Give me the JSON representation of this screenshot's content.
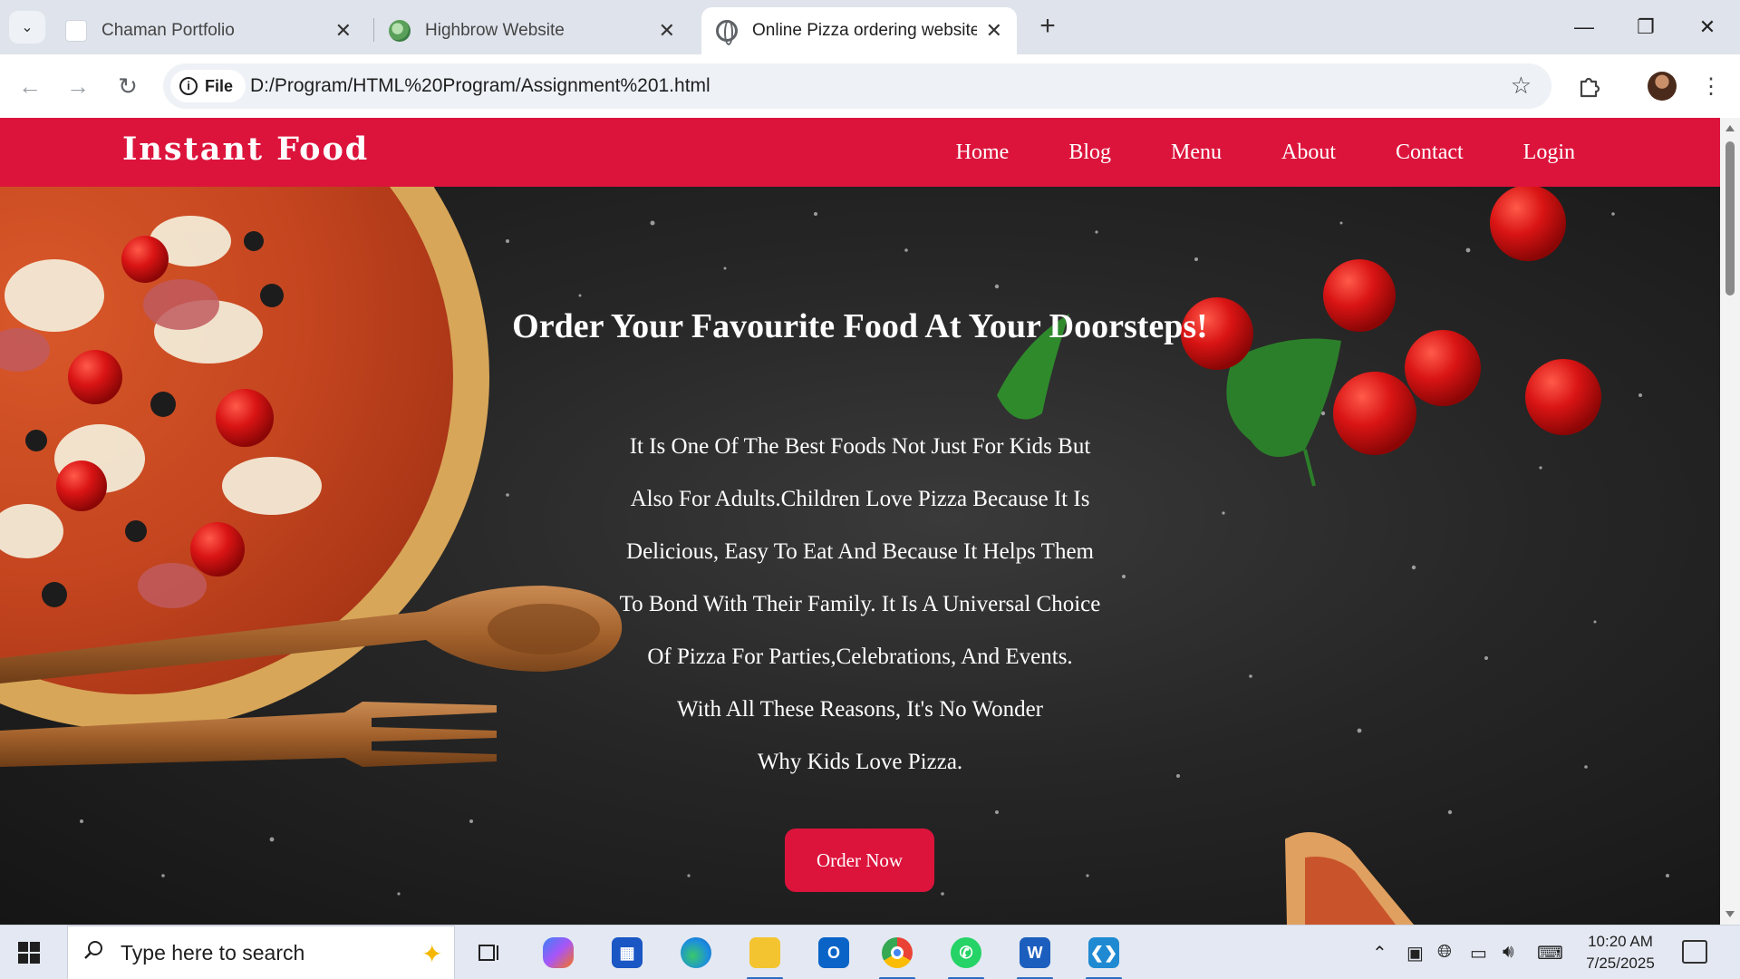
{
  "browser": {
    "tabs": [
      {
        "title": "Chaman Portfolio",
        "favicon": "document-icon",
        "active": false
      },
      {
        "title": "Highbrow Website",
        "favicon": "leaf-logo-icon",
        "active": false
      },
      {
        "title": "Online Pizza ordering website",
        "favicon": "globe-icon",
        "active": true
      }
    ],
    "close_glyph": "✕",
    "new_tab_glyph": "+",
    "site_chip_label": "File",
    "url": "D:/Program/HTML%20Program/Assignment%201.html",
    "window_controls": {
      "minimize": "—",
      "restore": "❐",
      "close": "✕"
    }
  },
  "site": {
    "brand": "Instant Food",
    "nav": [
      "Home",
      "Blog",
      "Menu",
      "About",
      "Contact",
      "Login"
    ],
    "hero_title": "Order Your Favourite Food At Your Doorsteps!",
    "hero_lines": [
      "It Is One Of The Best Foods Not Just For Kids But",
      "Also For Adults.Children Love Pizza Because It Is",
      "Delicious, Easy To Eat And Because It Helps Them",
      "To Bond With Their Family. It Is A Universal Choice",
      "Of Pizza For Parties,Celebrations, And Events.",
      "With All These Reasons, It's No Wonder",
      "Why Kids Love Pizza."
    ],
    "order_button": "Order Now",
    "accent_color": "#dc143c"
  },
  "taskbar": {
    "search_placeholder": "Type here to search",
    "apps": [
      "task-view-icon",
      "copilot-icon",
      "microsoft-store-icon",
      "edge-icon",
      "file-explorer-icon",
      "outlook-icon",
      "chrome-icon",
      "whatsapp-icon",
      "word-icon",
      "vscode-icon"
    ],
    "time": "10:20 AM",
    "date": "7/25/2025"
  }
}
